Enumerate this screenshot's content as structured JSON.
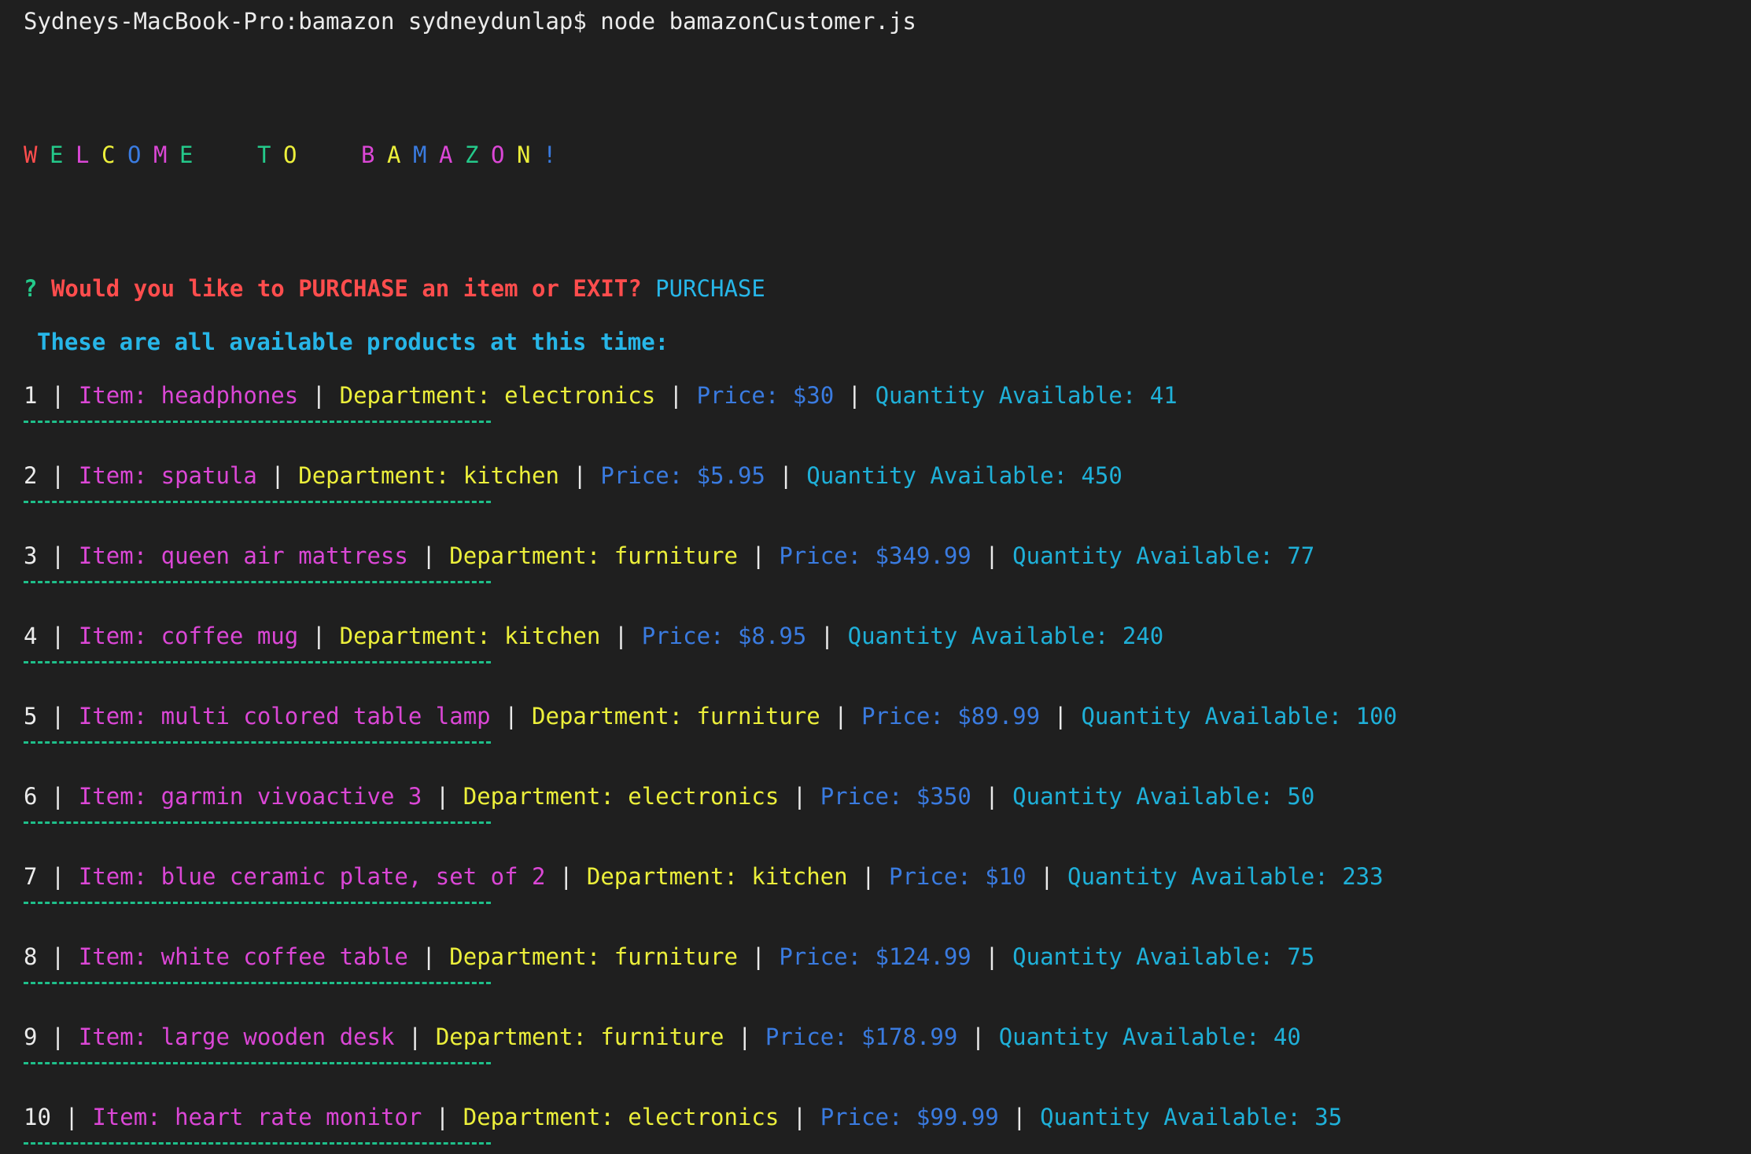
{
  "terminal": {
    "prompt": "Sydneys-MacBook-Pro:bamazon sydneydunlap$ node bamazonCustomer.js",
    "welcome": [
      {
        "ch": "W",
        "color": "#ff4d4d"
      },
      {
        "ch": "E",
        "color": "#24c98a"
      },
      {
        "ch": "L",
        "color": "#db47d6"
      },
      {
        "ch": "C",
        "color": "#ecef3b"
      },
      {
        "ch": "O",
        "color": "#3a7be0"
      },
      {
        "ch": "M",
        "color": "#db47d6"
      },
      {
        "ch": "E",
        "color": "#24c98a"
      },
      {
        "ch": " ",
        "color": "#ebebeb"
      },
      {
        "ch": " ",
        "color": "#ebebeb"
      },
      {
        "ch": "T",
        "color": "#24c98a"
      },
      {
        "ch": "O",
        "color": "#ecef3b"
      },
      {
        "ch": " ",
        "color": "#ebebeb"
      },
      {
        "ch": " ",
        "color": "#ebebeb"
      },
      {
        "ch": "B",
        "color": "#db47d6"
      },
      {
        "ch": "A",
        "color": "#ecef3b"
      },
      {
        "ch": "M",
        "color": "#3a7be0"
      },
      {
        "ch": "A",
        "color": "#db47d6"
      },
      {
        "ch": "Z",
        "color": "#24c98a"
      },
      {
        "ch": "O",
        "color": "#db47d6"
      },
      {
        "ch": "N",
        "color": "#ecef3b"
      },
      {
        "ch": "!",
        "color": "#3a7be0"
      }
    ],
    "question": {
      "mark": "?",
      "text": "Would you like to PURCHASE an item or EXIT?",
      "answer": "PURCHASE"
    },
    "header": "These are all available products at this time:",
    "products": [
      {
        "id": "1",
        "item": "Item: headphones",
        "dept": "Department: electronics",
        "price": "Price: $30",
        "qty": "Quantity Available: 41"
      },
      {
        "id": "2",
        "item": "Item: spatula",
        "dept": "Department: kitchen",
        "price": "Price: $5.95",
        "qty": "Quantity Available: 450"
      },
      {
        "id": "3",
        "item": "Item: queen air mattress",
        "dept": "Department: furniture",
        "price": "Price: $349.99",
        "qty": "Quantity Available: 77"
      },
      {
        "id": "4",
        "item": "Item: coffee mug",
        "dept": "Department: kitchen",
        "price": "Price: $8.95",
        "qty": "Quantity Available: 240"
      },
      {
        "id": "5",
        "item": "Item: multi colored table lamp",
        "dept": "Department: furniture",
        "price": "Price: $89.99",
        "qty": "Quantity Available: 100"
      },
      {
        "id": "6",
        "item": "Item: garmin vivoactive 3",
        "dept": "Department: electronics",
        "price": "Price: $350",
        "qty": "Quantity Available: 50"
      },
      {
        "id": "7",
        "item": "Item: blue ceramic plate, set of 2",
        "dept": "Department: kitchen",
        "price": "Price: $10",
        "qty": "Quantity Available: 233"
      },
      {
        "id": "8",
        "item": "Item: white coffee table",
        "dept": "Department: furniture",
        "price": "Price: $124.99",
        "qty": "Quantity Available: 75"
      },
      {
        "id": "9",
        "item": "Item: large wooden desk",
        "dept": "Department: furniture",
        "price": "Price: $178.99",
        "qty": "Quantity Available: 40"
      },
      {
        "id": "10",
        "item": "Item: heart rate monitor",
        "dept": "Department: electronics",
        "price": "Price: $99.99",
        "qty": "Quantity Available: 35"
      }
    ],
    "separator": " | ",
    "colors": {
      "background": "#1f1f1f",
      "text": "#ebebeb",
      "item": "#db47d6",
      "department": "#ecef3b",
      "price": "#3a7be0",
      "quantity": "#1fb0d8",
      "divider": "#1fbf8a",
      "question": "#ff4d4d",
      "answer": "#27b6e8"
    }
  }
}
